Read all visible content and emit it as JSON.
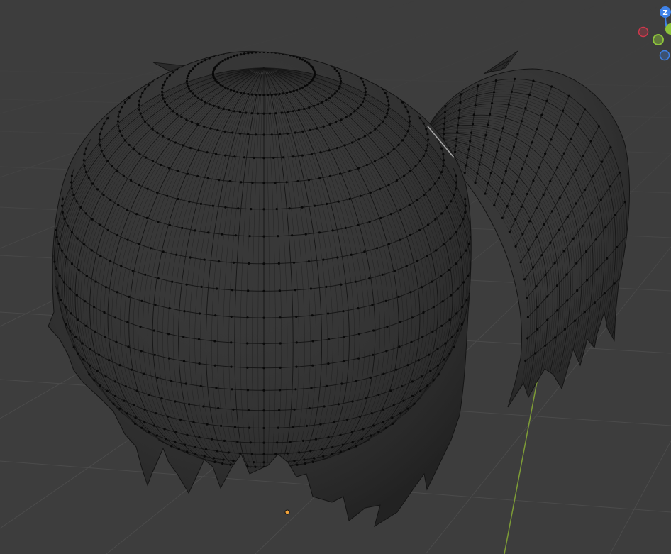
{
  "viewport": {
    "background_color": "#3d3d3d",
    "grid_color": "#4b4b4b",
    "y_axis_color": "#7d9c36"
  },
  "mesh": {
    "fill_color": "#2a2a2a",
    "edge_color": "#141414",
    "vertex_color": "#080808",
    "highlight_color": "#c4c4c4"
  },
  "object_origin": {
    "color": "#f2a33a"
  },
  "gizmo": {
    "z_label": "Z",
    "x_color": "#d0384c",
    "y_color": "#8dc33b",
    "z_color": "#3f82e8"
  }
}
